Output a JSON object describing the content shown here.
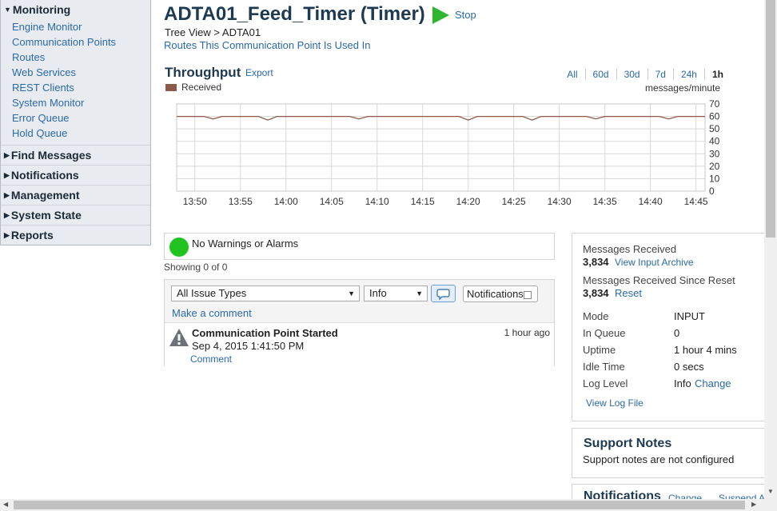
{
  "sidebar": {
    "monitoring_title": "Monitoring",
    "items": [
      {
        "label": "Engine Monitor"
      },
      {
        "label": "Communication Points"
      },
      {
        "label": "Routes"
      },
      {
        "label": "Web Services"
      },
      {
        "label": "REST Clients"
      },
      {
        "label": "System Monitor"
      },
      {
        "label": "Error Queue"
      },
      {
        "label": "Hold Queue"
      }
    ],
    "sections": [
      {
        "label": "Find Messages"
      },
      {
        "label": "Notifications"
      },
      {
        "label": "Management"
      },
      {
        "label": "System State"
      },
      {
        "label": "Reports"
      }
    ]
  },
  "header": {
    "title": "ADTA01_Feed_Timer (Timer)",
    "stop_label": "Stop",
    "breadcrumb": "Tree View > ADTA01",
    "routes_link": "Routes This Communication Point Is Used In"
  },
  "throughput": {
    "title": "Throughput",
    "export_label": "Export",
    "ranges": [
      "All",
      "60d",
      "30d",
      "7d",
      "24h",
      "1h"
    ],
    "selected_range": "1h",
    "legend_label": "Received",
    "legend_color": "#8b5a48",
    "units": "messages/minute"
  },
  "chart_data": {
    "type": "line",
    "x": [
      "13:48",
      "13:49",
      "13:50",
      "13:51",
      "13:52",
      "13:53",
      "13:54",
      "13:55",
      "13:56",
      "13:57",
      "13:58",
      "13:59",
      "14:00",
      "14:01",
      "14:02",
      "14:03",
      "14:04",
      "14:05",
      "14:06",
      "14:07",
      "14:08",
      "14:09",
      "14:10",
      "14:11",
      "14:12",
      "14:13",
      "14:14",
      "14:15",
      "14:16",
      "14:17",
      "14:18",
      "14:19",
      "14:20",
      "14:21",
      "14:22",
      "14:23",
      "14:24",
      "14:25",
      "14:26",
      "14:27",
      "14:28",
      "14:29",
      "14:30",
      "14:31",
      "14:32",
      "14:33",
      "14:34",
      "14:35",
      "14:36",
      "14:37",
      "14:38",
      "14:39",
      "14:40",
      "14:41",
      "14:42",
      "14:43",
      "14:44",
      "14:45",
      "14:46"
    ],
    "series": [
      {
        "name": "Received",
        "color": "#8b5a48",
        "values": [
          60,
          60,
          60,
          60,
          58,
          60,
          60,
          60,
          60,
          60,
          57,
          60,
          60,
          60,
          60,
          60,
          60,
          60,
          60,
          60,
          58,
          60,
          60,
          60,
          60,
          60,
          60,
          60,
          60,
          60,
          60,
          60,
          57,
          60,
          60,
          60,
          60,
          60,
          60,
          57,
          60,
          60,
          60,
          60,
          60,
          60,
          58,
          60,
          60,
          60,
          60,
          60,
          60,
          60,
          58,
          60,
          60,
          60,
          60
        ]
      }
    ],
    "x_ticks": [
      "13:50",
      "13:55",
      "14:00",
      "14:05",
      "14:10",
      "14:15",
      "14:20",
      "14:25",
      "14:30",
      "14:35",
      "14:40",
      "14:45"
    ],
    "y_ticks": [
      0,
      10,
      20,
      30,
      40,
      50,
      60,
      70
    ],
    "ylim": [
      0,
      70
    ],
    "grid": true,
    "y_axis_position": "right"
  },
  "alerts": {
    "status_text": "No Warnings or Alarms",
    "status_color": "#21c321",
    "showing": "Showing 0 of 0"
  },
  "issues": {
    "type_select": "All Issue Types",
    "level_select": "Info",
    "notifications_label": "Notifications",
    "make_comment": "Make a comment",
    "events": [
      {
        "title": "Communication Point Started",
        "date": "Sep 4, 2015 1:41:50 PM",
        "comment_label": "Comment",
        "age": "1 hour ago"
      }
    ]
  },
  "stats": {
    "messages_received_label": "Messages Received",
    "messages_received_value": "3,834",
    "view_archive": "View Input Archive",
    "since_reset_label": "Messages Received Since Reset",
    "since_reset_value": "3,834",
    "reset_label": "Reset",
    "mode_label": "Mode",
    "mode_value": "INPUT",
    "queue_label": "In Queue",
    "queue_value": "0",
    "uptime_label": "Uptime",
    "uptime_value": "1 hour 4 mins",
    "idle_label": "Idle Time",
    "idle_value": "0 secs",
    "log_label": "Log Level",
    "log_value": "Info",
    "log_change": "Change",
    "view_log": "View Log File"
  },
  "support": {
    "title": "Support Notes",
    "text": "Support notes are not configured"
  },
  "notifications_panel": {
    "title": "Notifications",
    "change": "Change",
    "suspend": "Suspend A"
  }
}
